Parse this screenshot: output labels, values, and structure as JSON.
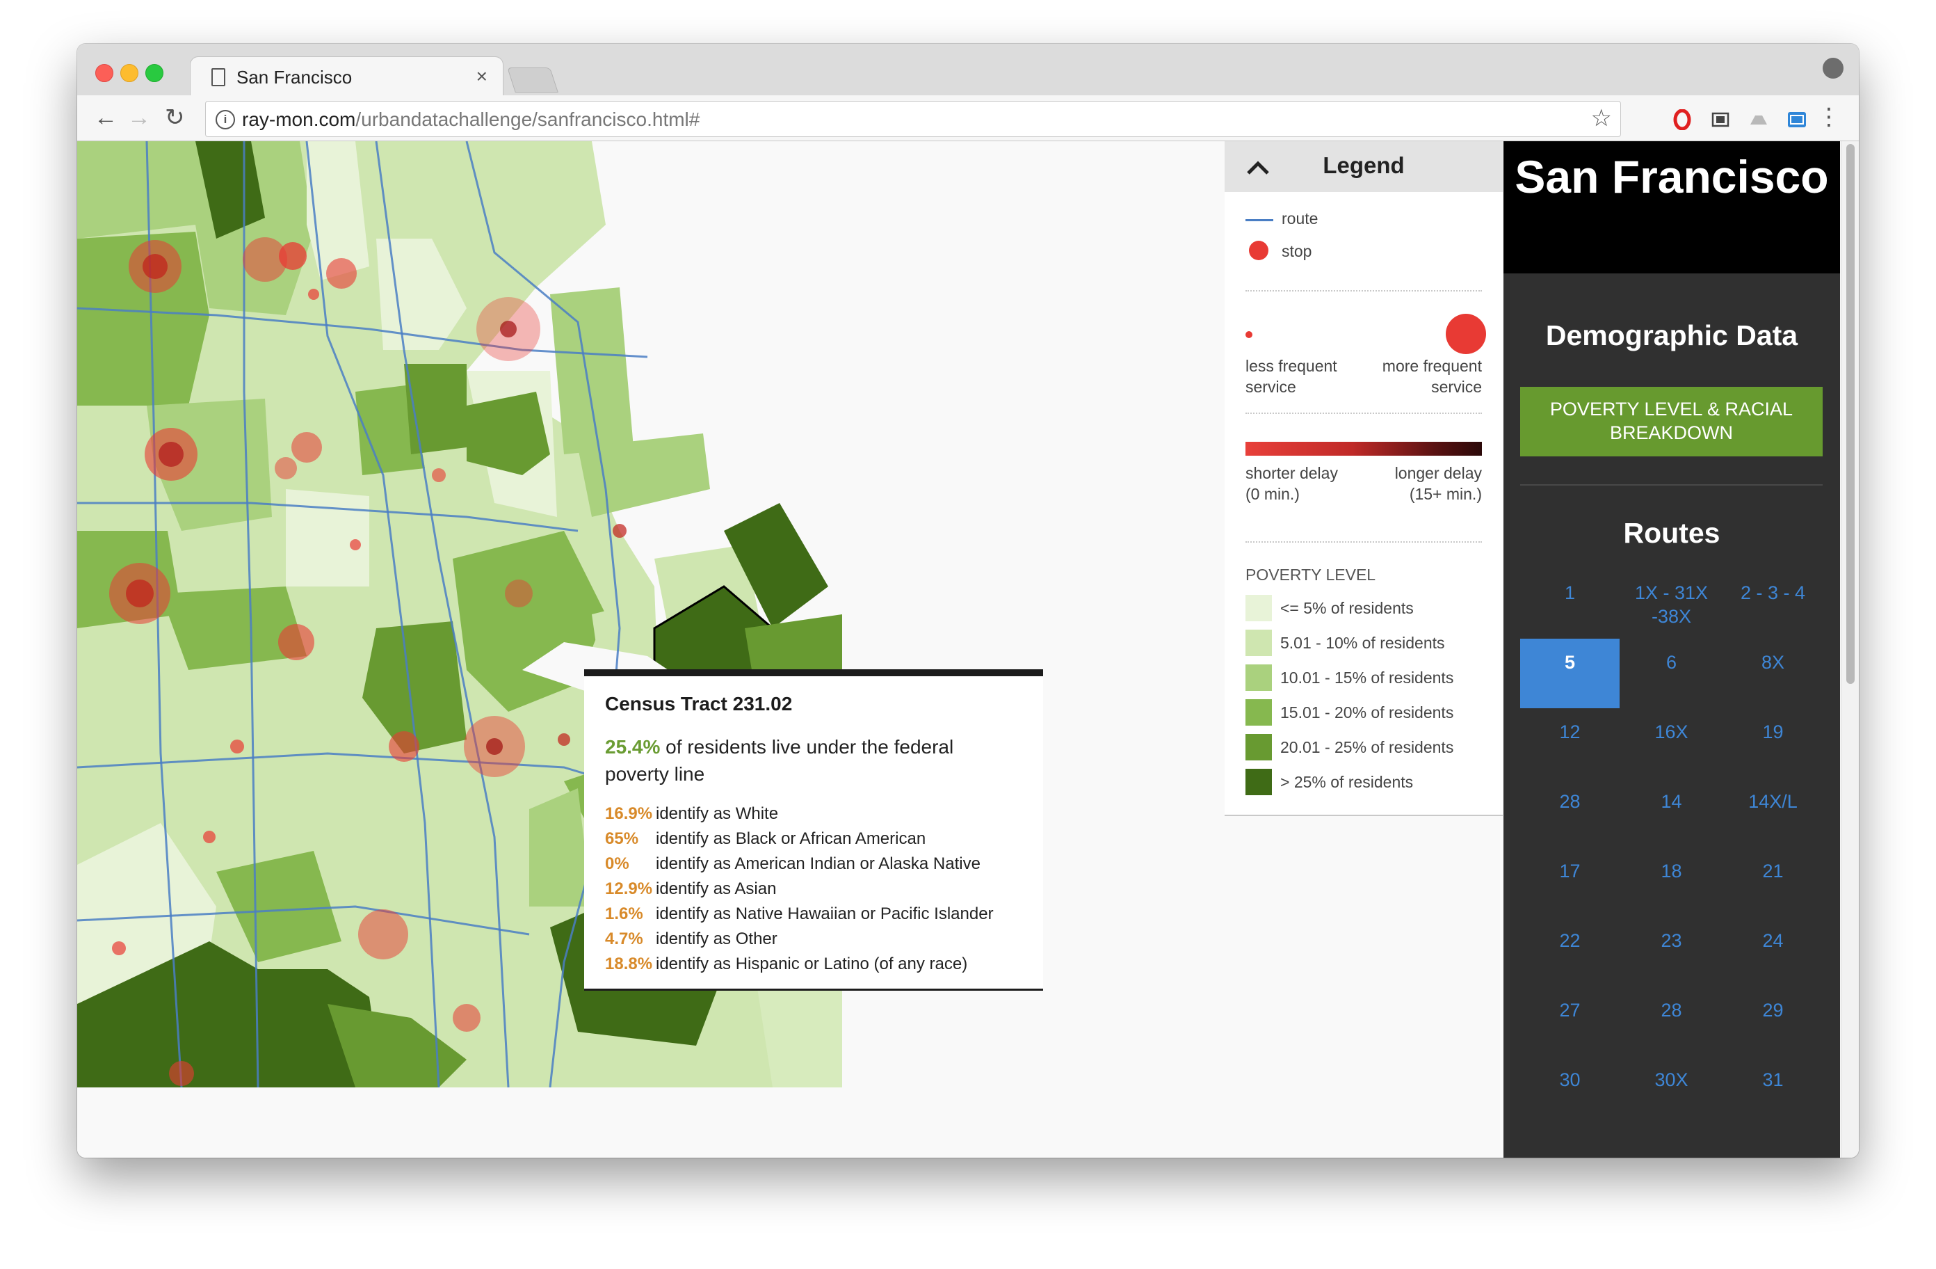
{
  "browser": {
    "tab_title": "San Francisco",
    "tab_close": "×",
    "url_host": "ray-mon.com",
    "url_path": "/urbandatachallenge/sanfrancisco.html#",
    "back_glyph": "←",
    "forward_glyph": "→",
    "reload_glyph": "↻",
    "star_glyph": "☆",
    "menu_glyph": "⋮",
    "info_glyph": "i",
    "extensions": [
      "opera-icon",
      "screenshot-icon",
      "drive-icon",
      "css-icon"
    ]
  },
  "tooltip": {
    "title": "Census Tract 231.02",
    "poverty_pct": "25.4%",
    "poverty_text": " of residents live under the federal poverty line",
    "rows": [
      {
        "pct": "16.9%",
        "label": "identify as White"
      },
      {
        "pct": "65%",
        "label": "identify as Black or African American"
      },
      {
        "pct": "0%",
        "label": "identify as American Indian or Alaska Native"
      },
      {
        "pct": "12.9%",
        "label": "identify as Asian"
      },
      {
        "pct": "1.6%",
        "label": "identify as Native Hawaiian or Pacific Islander"
      },
      {
        "pct": "4.7%",
        "label": "identify as Other"
      },
      {
        "pct": "18.8%",
        "label": "identify as Hispanic or Latino (of any race)"
      }
    ]
  },
  "legend": {
    "title": "Legend",
    "chevron": "^",
    "route_label": "route",
    "stop_label": "stop",
    "less_freq": "less frequent service",
    "more_freq": "more frequent service",
    "shorter_delay": "shorter delay (0 min.)",
    "longer_delay": "longer delay (15+ min.)",
    "poverty_heading": "POVERTY LEVEL",
    "poverty_levels": [
      {
        "label": "<= 5% of residents",
        "color": "#e8f3d8"
      },
      {
        "label": "5.01 - 10% of residents",
        "color": "#cfe6b0"
      },
      {
        "label": "10.01 - 15% of residents",
        "color": "#aad17e"
      },
      {
        "label": "15.01 - 20% of residents",
        "color": "#86b84f"
      },
      {
        "label": "20.01 - 25% of residents",
        "color": "#689a31"
      },
      {
        "label": "> 25% of residents",
        "color": "#3f6b16"
      }
    ],
    "colors": {
      "route": "#4a7ec4",
      "stop": "#e83a34"
    }
  },
  "panel": {
    "title": "San Francisco",
    "demographic_title": "Demographic Data",
    "poverty_button": "POVERTY LEVEL & RACIAL BREAKDOWN",
    "routes_title": "Routes",
    "routes": [
      "1",
      "1X - 31X -38X",
      "2 - 3 - 4",
      "5",
      "6",
      "8X",
      "12",
      "16X",
      "19",
      "28",
      "14",
      "14X/L",
      "17",
      "18",
      "21",
      "22",
      "23",
      "24",
      "27",
      "28",
      "29",
      "30",
      "30X",
      "31"
    ],
    "active_route": "5",
    "colors": {
      "accent": "#3e86d6",
      "button": "#679a2f",
      "panel": "#303030"
    }
  }
}
